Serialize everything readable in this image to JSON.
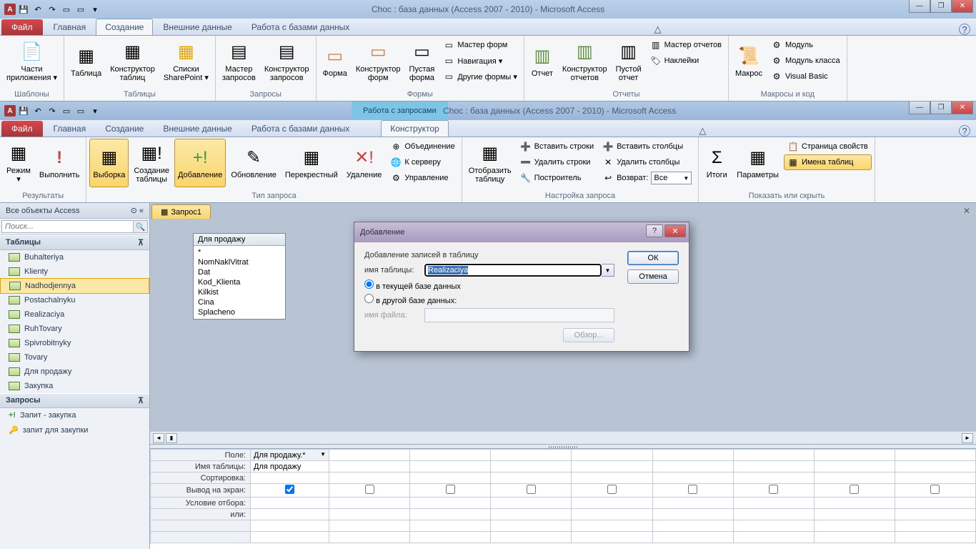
{
  "win1": {
    "title": "Choc : база данных (Access 2007 - 2010)  -  Microsoft Access",
    "tabs": {
      "file": "Файл",
      "home": "Главная",
      "create": "Создание",
      "external": "Внешние данные",
      "dbtools": "Работа с базами данных"
    },
    "ribbon": {
      "g1": {
        "label": "Шаблоны",
        "parts": "Части\nприложения ▾"
      },
      "g2": {
        "label": "Таблицы",
        "table": "Таблица",
        "design": "Конструктор\nтаблиц",
        "sp": "Списки\nSharePoint ▾"
      },
      "g3": {
        "label": "Запросы",
        "wiz": "Мастер\nзапросов",
        "design": "Конструктор\nзапросов"
      },
      "g4": {
        "label": "Формы",
        "form": "Форма",
        "design": "Конструктор\nформ",
        "blank": "Пустая\nформа",
        "fw": "Мастер форм",
        "nav": "Навигация ▾",
        "other": "Другие формы ▾"
      },
      "g5": {
        "label": "Отчеты",
        "rep": "Отчет",
        "design": "Конструктор\nотчетов",
        "blank": "Пустой\nотчет",
        "rw": "Мастер отчетов",
        "lbl": "Наклейки"
      },
      "g6": {
        "label": "Макросы и код",
        "macro": "Макрос",
        "module": "Модуль",
        "cmodule": "Модуль класса",
        "vb": "Visual Basic"
      }
    }
  },
  "win2": {
    "title": "Choc : база данных (Access 2007 - 2010)  -  Microsoft Access",
    "ctx_title": "Работа с запросами",
    "tabs": {
      "file": "Файл",
      "home": "Главная",
      "create": "Создание",
      "external": "Внешние данные",
      "dbtools": "Работа с базами данных",
      "ctx": "Конструктор"
    },
    "ribbon": {
      "g1": {
        "label": "Результаты",
        "view": "Режим",
        "run": "Выполнить"
      },
      "g2": {
        "label": "Тип запроса",
        "select": "Выборка",
        "maketable": "Создание\nтаблицы",
        "append": "Добавление",
        "update": "Обновление",
        "crosstab": "Перекрестный",
        "delete": "Удаление",
        "union": "Объединение",
        "pass": "К серверу",
        "ddl": "Управление"
      },
      "g3": {
        "label": "Настройка запроса",
        "show": "Отобразить\nтаблицу",
        "insrow": "Вставить строки",
        "delrow": "Удалить строки",
        "builder": "Построитель",
        "inscol": "Вставить столбцы",
        "delcol": "Удалить столбцы",
        "return": "Возврат:",
        "return_val": "Все"
      },
      "g4": {
        "label": "Показать или скрыть",
        "totals": "Итоги",
        "params": "Параметры",
        "prop": "Страница свойств",
        "names": "Имена таблиц"
      }
    }
  },
  "nav": {
    "header": "Все объекты Access",
    "search": "Поиск...",
    "g_tables": "Таблицы",
    "tables": [
      "Buhalteriya",
      "Klienty",
      "Nadhodjennya",
      "Postachalnyku",
      "Realizaciya",
      "RuhTovary",
      "Spivrobitnyky",
      "Tovary",
      "Для продажу",
      "Закупка"
    ],
    "sel_table": "Nadhodjennya",
    "g_queries": "Запросы",
    "queries": [
      "Запит - закупка",
      "запит для закупки"
    ]
  },
  "doc": {
    "tab": "Запрос1",
    "table": {
      "title": "Для продажу",
      "fields": [
        "*",
        "NomNaklVitrat",
        "Dat",
        "Kod_Klienta",
        "Kilkist",
        "Cina",
        "Splacheno"
      ]
    }
  },
  "qbe": {
    "rows": {
      "field": "Поле:",
      "table": "Имя таблицы:",
      "sort": "Сортировка:",
      "show": "Вывод на экран:",
      "criteria": "Условие отбора:",
      "or": "или:"
    },
    "col1": {
      "field": "Для продажу.*",
      "table": "Для продажу"
    }
  },
  "dialog": {
    "title": "Добавление",
    "group": "Добавление записей в таблицу",
    "tbl_label": "имя таблицы:",
    "tbl_value": "Realizaciya",
    "opt_current": "в текущей базе данных",
    "opt_other": "в другой базе данных:",
    "file_label": "имя файла:",
    "browse": "Обзор...",
    "ok": "ОК",
    "cancel": "Отмена"
  }
}
